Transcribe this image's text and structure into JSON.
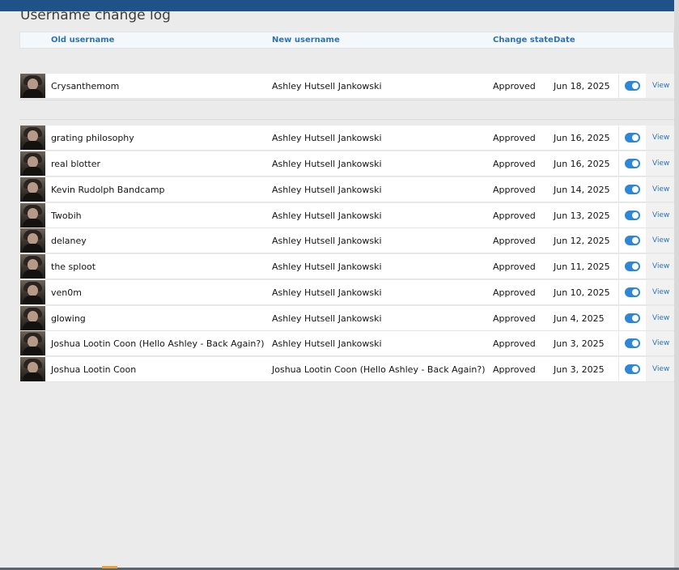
{
  "page": {
    "title": "Username change log"
  },
  "table": {
    "columns": {
      "old_username": "Old username",
      "new_username": "New username",
      "change_state": "Change state",
      "date": "Date"
    },
    "view_label": "View",
    "rows": [
      {
        "old": "Crysanthemom",
        "new": "Ashley Hutsell Jankowski",
        "state": "Approved",
        "date": "Jun 18, 2025",
        "enabled": true
      },
      {
        "old": "grating philosophy",
        "new": "Ashley Hutsell Jankowski",
        "state": "Approved",
        "date": "Jun 16, 2025",
        "enabled": true
      },
      {
        "old": "real blotter",
        "new": "Ashley Hutsell Jankowski",
        "state": "Approved",
        "date": "Jun 16, 2025",
        "enabled": true
      },
      {
        "old": "Kevin Rudolph Bandcamp",
        "new": "Ashley Hutsell Jankowski",
        "state": "Approved",
        "date": "Jun 14, 2025",
        "enabled": true
      },
      {
        "old": "Twobih",
        "new": "Ashley Hutsell Jankowski",
        "state": "Approved",
        "date": "Jun 13, 2025",
        "enabled": true
      },
      {
        "old": "delaney",
        "new": "Ashley Hutsell Jankowski",
        "state": "Approved",
        "date": "Jun 12, 2025",
        "enabled": true
      },
      {
        "old": "the sploot",
        "new": "Ashley Hutsell Jankowski",
        "state": "Approved",
        "date": "Jun 11, 2025",
        "enabled": true
      },
      {
        "old": "ven0m",
        "new": "Ashley Hutsell Jankowski",
        "state": "Approved",
        "date": "Jun 10, 2025",
        "enabled": true
      },
      {
        "old": "glowing",
        "new": "Ashley Hutsell Jankowski",
        "state": "Approved",
        "date": "Jun 4, 2025",
        "enabled": true
      },
      {
        "old": "Joshua Lootin Coon (Hello Ashley - Back Again?)",
        "new": "Ashley Hutsell Jankowski",
        "state": "Approved",
        "date": "Jun 3, 2025",
        "enabled": true
      },
      {
        "old": "Joshua Lootin Coon",
        "new": "Joshua Lootin Coon (Hello Ashley - Back Again?)",
        "state": "Approved",
        "date": "Jun 3, 2025",
        "enabled": true
      }
    ]
  },
  "colors": {
    "accent": "#2d73b4",
    "toggle_on": "#2f86d6",
    "topbar": "#1e5289"
  }
}
